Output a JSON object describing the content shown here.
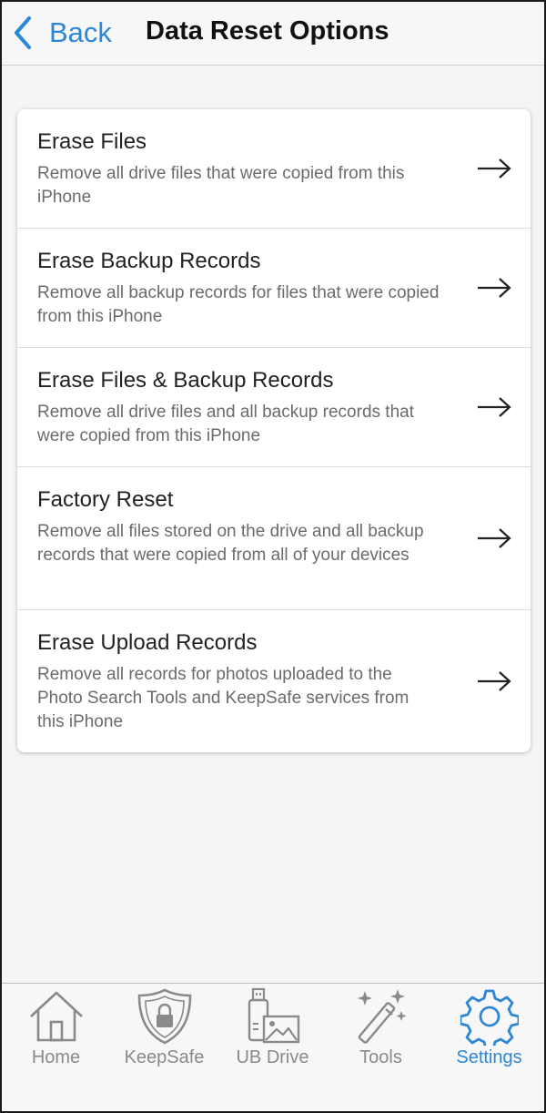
{
  "header": {
    "back_label": "Back",
    "title": "Data Reset Options"
  },
  "options": [
    {
      "title": "Erase Files",
      "description": "Remove all drive files that were copied from this iPhone"
    },
    {
      "title": "Erase Backup Records",
      "description": "Remove all backup records for files that were copied from this iPhone"
    },
    {
      "title": "Erase Files & Backup Records",
      "description": "Remove all drive files and all backup records that were copied from this iPhone"
    },
    {
      "title": "Factory Reset",
      "description": "Remove all files stored on the drive and all backup records that were copied from all of your devices"
    },
    {
      "title": "Erase Upload Records",
      "description": "Remove all records for photos uploaded to the Photo Search Tools and KeepSafe services from this iPhone"
    }
  ],
  "tabs": [
    {
      "label": "Home",
      "icon": "home-icon"
    },
    {
      "label": "KeepSafe",
      "icon": "shield-lock-icon"
    },
    {
      "label": "UB Drive",
      "icon": "usb-drive-icon"
    },
    {
      "label": "Tools",
      "icon": "magic-wand-icon"
    },
    {
      "label": "Settings",
      "icon": "gear-icon",
      "active": true
    }
  ],
  "colors": {
    "accent": "#2e87d6",
    "inactive": "#8a8a8a"
  }
}
